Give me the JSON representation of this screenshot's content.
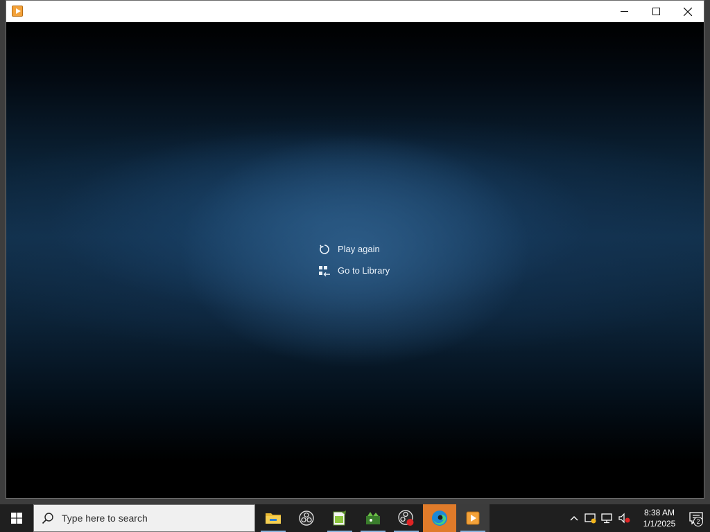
{
  "window": {
    "title": "",
    "controls": {
      "minimize": "minimize",
      "maximize": "maximize",
      "close": "close"
    }
  },
  "player": {
    "menu": [
      {
        "label": "Play again",
        "icon": "replay-icon"
      },
      {
        "label": "Go to Library",
        "icon": "library-icon"
      }
    ]
  },
  "taskbar": {
    "search_placeholder": "Type here to search",
    "apps": [
      {
        "name": "file-explorer",
        "running": true
      },
      {
        "name": "obs-studio",
        "running": false
      },
      {
        "name": "notepad-plus-plus",
        "running": true
      },
      {
        "name": "cygwin-app",
        "running": true
      },
      {
        "name": "obs-recording",
        "running": true
      },
      {
        "name": "microsoft-edge",
        "running": false
      },
      {
        "name": "media-player",
        "running": true
      }
    ],
    "clock": {
      "time": "8:38 AM",
      "date": "1/1/2025"
    },
    "notifications": "2"
  },
  "colors": {
    "taskbar": "#1f1f1f",
    "accent_highlight": "#e07b2a",
    "running_indicator": "#8ab4de"
  }
}
